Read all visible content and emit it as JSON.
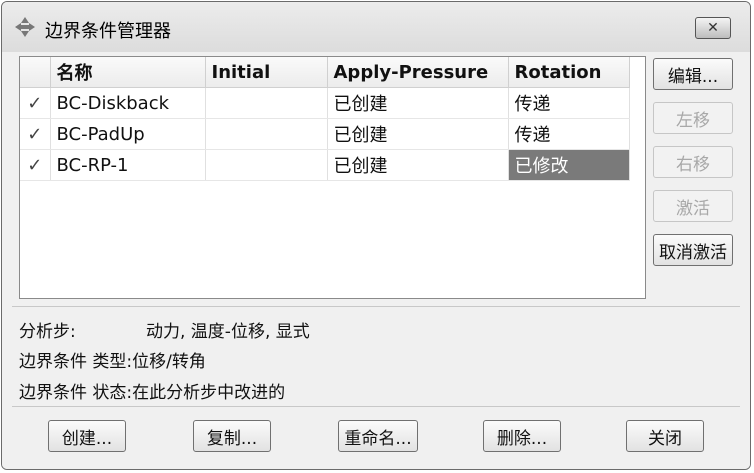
{
  "window": {
    "title": "边界条件管理器",
    "close_label": "✕"
  },
  "table": {
    "columns": [
      "",
      "名称",
      "Initial",
      "Apply-Pressure",
      "Rotation"
    ],
    "rows": [
      {
        "check": "✓",
        "name": "BC-Diskback",
        "initial": "",
        "apply_pressure": "已创建",
        "rotation": "传递"
      },
      {
        "check": "✓",
        "name": "BC-PadUp",
        "initial": "",
        "apply_pressure": "已创建",
        "rotation": "传递"
      },
      {
        "check": "✓",
        "name": "BC-RP-1",
        "initial": "",
        "apply_pressure": "已创建",
        "rotation": "已修改"
      }
    ]
  },
  "side_buttons": {
    "edit": "编辑...",
    "move_left": "左移",
    "move_right": "右移",
    "activate": "激活",
    "deactivate": "取消激活"
  },
  "info": {
    "step_label": "分析步:",
    "step_value": "动力, 温度-位移, 显式",
    "type_label": "边界条件 类型:",
    "type_value": "位移/转角",
    "status_label": "边界条件 状态:",
    "status_value": "在此分析步中改进的"
  },
  "bottom_buttons": {
    "create": "创建...",
    "copy": "复制...",
    "rename": "重命名...",
    "delete": "删除...",
    "close": "关闭"
  }
}
